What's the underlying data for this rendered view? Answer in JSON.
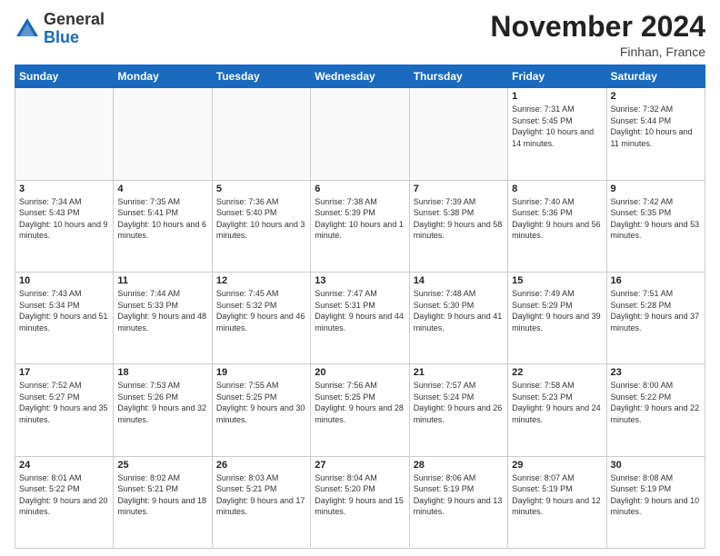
{
  "header": {
    "logo_general": "General",
    "logo_blue": "Blue",
    "month_title": "November 2024",
    "location": "Finhan, France"
  },
  "weekdays": [
    "Sunday",
    "Monday",
    "Tuesday",
    "Wednesday",
    "Thursday",
    "Friday",
    "Saturday"
  ],
  "weeks": [
    [
      {
        "day": "",
        "info": ""
      },
      {
        "day": "",
        "info": ""
      },
      {
        "day": "",
        "info": ""
      },
      {
        "day": "",
        "info": ""
      },
      {
        "day": "",
        "info": ""
      },
      {
        "day": "1",
        "info": "Sunrise: 7:31 AM\nSunset: 5:45 PM\nDaylight: 10 hours and 14 minutes."
      },
      {
        "day": "2",
        "info": "Sunrise: 7:32 AM\nSunset: 5:44 PM\nDaylight: 10 hours and 11 minutes."
      }
    ],
    [
      {
        "day": "3",
        "info": "Sunrise: 7:34 AM\nSunset: 5:43 PM\nDaylight: 10 hours and 9 minutes."
      },
      {
        "day": "4",
        "info": "Sunrise: 7:35 AM\nSunset: 5:41 PM\nDaylight: 10 hours and 6 minutes."
      },
      {
        "day": "5",
        "info": "Sunrise: 7:36 AM\nSunset: 5:40 PM\nDaylight: 10 hours and 3 minutes."
      },
      {
        "day": "6",
        "info": "Sunrise: 7:38 AM\nSunset: 5:39 PM\nDaylight: 10 hours and 1 minute."
      },
      {
        "day": "7",
        "info": "Sunrise: 7:39 AM\nSunset: 5:38 PM\nDaylight: 9 hours and 58 minutes."
      },
      {
        "day": "8",
        "info": "Sunrise: 7:40 AM\nSunset: 5:36 PM\nDaylight: 9 hours and 56 minutes."
      },
      {
        "day": "9",
        "info": "Sunrise: 7:42 AM\nSunset: 5:35 PM\nDaylight: 9 hours and 53 minutes."
      }
    ],
    [
      {
        "day": "10",
        "info": "Sunrise: 7:43 AM\nSunset: 5:34 PM\nDaylight: 9 hours and 51 minutes."
      },
      {
        "day": "11",
        "info": "Sunrise: 7:44 AM\nSunset: 5:33 PM\nDaylight: 9 hours and 48 minutes."
      },
      {
        "day": "12",
        "info": "Sunrise: 7:45 AM\nSunset: 5:32 PM\nDaylight: 9 hours and 46 minutes."
      },
      {
        "day": "13",
        "info": "Sunrise: 7:47 AM\nSunset: 5:31 PM\nDaylight: 9 hours and 44 minutes."
      },
      {
        "day": "14",
        "info": "Sunrise: 7:48 AM\nSunset: 5:30 PM\nDaylight: 9 hours and 41 minutes."
      },
      {
        "day": "15",
        "info": "Sunrise: 7:49 AM\nSunset: 5:29 PM\nDaylight: 9 hours and 39 minutes."
      },
      {
        "day": "16",
        "info": "Sunrise: 7:51 AM\nSunset: 5:28 PM\nDaylight: 9 hours and 37 minutes."
      }
    ],
    [
      {
        "day": "17",
        "info": "Sunrise: 7:52 AM\nSunset: 5:27 PM\nDaylight: 9 hours and 35 minutes."
      },
      {
        "day": "18",
        "info": "Sunrise: 7:53 AM\nSunset: 5:26 PM\nDaylight: 9 hours and 32 minutes."
      },
      {
        "day": "19",
        "info": "Sunrise: 7:55 AM\nSunset: 5:25 PM\nDaylight: 9 hours and 30 minutes."
      },
      {
        "day": "20",
        "info": "Sunrise: 7:56 AM\nSunset: 5:25 PM\nDaylight: 9 hours and 28 minutes."
      },
      {
        "day": "21",
        "info": "Sunrise: 7:57 AM\nSunset: 5:24 PM\nDaylight: 9 hours and 26 minutes."
      },
      {
        "day": "22",
        "info": "Sunrise: 7:58 AM\nSunset: 5:23 PM\nDaylight: 9 hours and 24 minutes."
      },
      {
        "day": "23",
        "info": "Sunrise: 8:00 AM\nSunset: 5:22 PM\nDaylight: 9 hours and 22 minutes."
      }
    ],
    [
      {
        "day": "24",
        "info": "Sunrise: 8:01 AM\nSunset: 5:22 PM\nDaylight: 9 hours and 20 minutes."
      },
      {
        "day": "25",
        "info": "Sunrise: 8:02 AM\nSunset: 5:21 PM\nDaylight: 9 hours and 18 minutes."
      },
      {
        "day": "26",
        "info": "Sunrise: 8:03 AM\nSunset: 5:21 PM\nDaylight: 9 hours and 17 minutes."
      },
      {
        "day": "27",
        "info": "Sunrise: 8:04 AM\nSunset: 5:20 PM\nDaylight: 9 hours and 15 minutes."
      },
      {
        "day": "28",
        "info": "Sunrise: 8:06 AM\nSunset: 5:19 PM\nDaylight: 9 hours and 13 minutes."
      },
      {
        "day": "29",
        "info": "Sunrise: 8:07 AM\nSunset: 5:19 PM\nDaylight: 9 hours and 12 minutes."
      },
      {
        "day": "30",
        "info": "Sunrise: 8:08 AM\nSunset: 5:19 PM\nDaylight: 9 hours and 10 minutes."
      }
    ]
  ]
}
